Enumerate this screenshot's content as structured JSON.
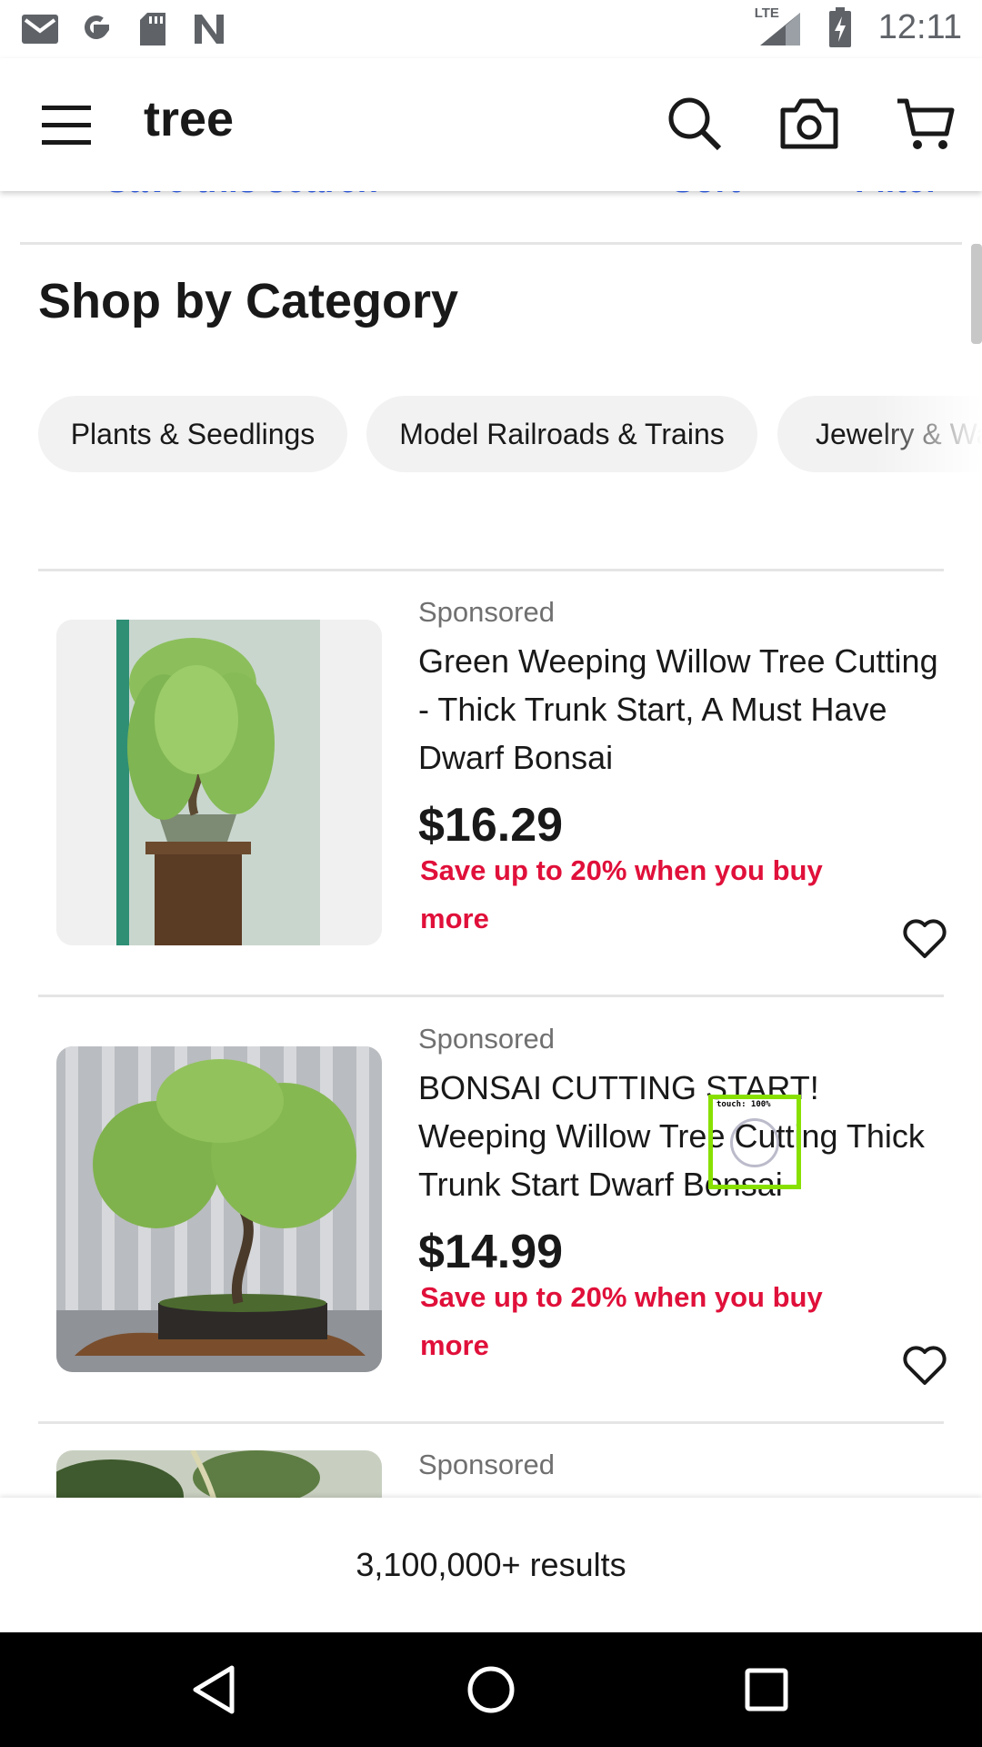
{
  "status_bar": {
    "time": "12:11",
    "network_label": "LTE",
    "left_icons": [
      "gmail-icon",
      "google-icon",
      "sd-card-icon",
      "n-icon"
    ],
    "right_icons": [
      "lte-signal-icon",
      "battery-charging-icon"
    ]
  },
  "header": {
    "query": "tree",
    "icons": [
      "menu-icon",
      "search-icon",
      "camera-icon",
      "cart-icon"
    ]
  },
  "toolbar": {
    "save_search_label": "Save this search",
    "sort_label": "Sort",
    "filter_label": "Filter"
  },
  "shop_by_category": {
    "title": "Shop by Category",
    "chips": [
      {
        "label": "Plants & Seedlings"
      },
      {
        "label": "Model Railroads & Trains"
      },
      {
        "label": "Jewelry & Wa"
      }
    ]
  },
  "listings": [
    {
      "sponsored": "Sponsored",
      "title": "Green Weeping Willow Tree Cutting - Thick Trunk Start, A Must Have Dwarf Bonsai",
      "price": "$16.29",
      "promo": "Save up to 20% when you buy more"
    },
    {
      "sponsored": "Sponsored",
      "title": "BONSAI CUTTING START! Weeping Willow Tree Cutting Thick Trunk Start Dwarf Bonsai",
      "price": "$14.99",
      "promo": "Save up to 20% when you buy more"
    },
    {
      "sponsored": "Sponsored"
    }
  ],
  "results": {
    "count_label": "3,100,000+ results"
  },
  "touch_indicator": {
    "label": "touch: 100%"
  },
  "nav_bar": {
    "icons": [
      "back-icon",
      "home-icon",
      "recents-icon"
    ]
  },
  "colors": {
    "accent": "#3665f3",
    "promo": "#e0103a",
    "text": "#191919",
    "muted": "#707070",
    "chip_bg": "#f2f2f2",
    "touch_box": "#88e000"
  }
}
